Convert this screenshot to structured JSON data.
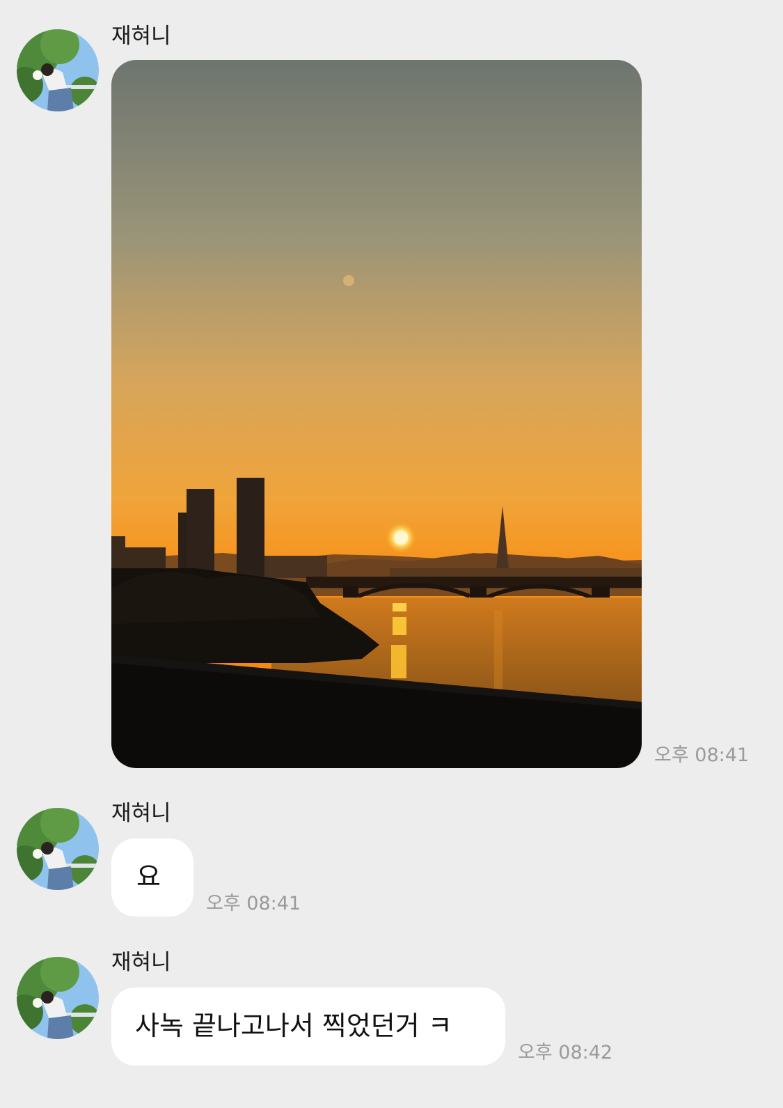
{
  "messages": [
    {
      "sender": "재혀니",
      "type": "image",
      "image_desc": "sunset-over-river-photo",
      "time": "오후 08:41"
    },
    {
      "sender": "재혀니",
      "type": "text",
      "text": "요",
      "time": "오후 08:41"
    },
    {
      "sender": "재혀니",
      "type": "text",
      "text": "사녹 끝나고나서 찍었던거 ㅋ",
      "time": "오후 08:42"
    }
  ],
  "colors": {
    "background": "#ededed",
    "bubble": "#ffffff",
    "timestamp": "#9a9a9a"
  }
}
